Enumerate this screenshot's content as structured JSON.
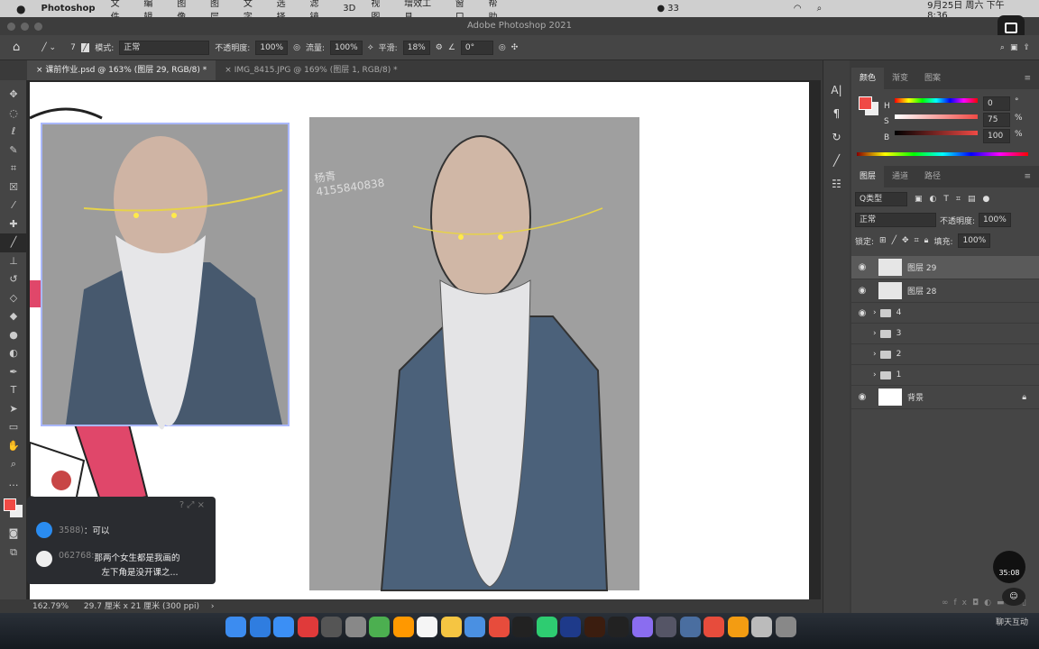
{
  "menubar": {
    "apple": "",
    "app": "Photoshop",
    "items": [
      "文件",
      "编辑",
      "图像",
      "图层",
      "文字",
      "选择",
      "滤镜",
      "3D",
      "视图",
      "增效工具",
      "窗口",
      "帮助"
    ],
    "battery_count": "33",
    "clock": "9月25日 周六 下午8:36"
  },
  "window": {
    "title": "Adobe Photoshop 2021"
  },
  "options": {
    "brush_size": "7",
    "mode_label": "模式:",
    "mode": "正常",
    "opacity_label": "不透明度:",
    "opacity": "100%",
    "flow_label": "流量:",
    "flow": "100%",
    "smooth_label": "平滑:",
    "smooth": "18%",
    "angle": "0°"
  },
  "tabs": [
    {
      "label": "课前作业.psd @ 163% (图层 29, RGB/8) *",
      "active": true
    },
    {
      "label": "IMG_8415.JPG @ 169% (图层 1, RGB/8) *",
      "active": false
    }
  ],
  "status": {
    "zoom": "162.79%",
    "size": "29.7 厘米 x 21 厘米 (300 ppi)",
    "arrow": "›"
  },
  "color_panel": {
    "tabs": [
      "颜色",
      "渐变",
      "图案"
    ],
    "h_label": "H",
    "s_label": "S",
    "b_label": "B",
    "h": "0",
    "s": "75",
    "b": "100",
    "deg": "°",
    "pct": "%",
    "foreground": "#f04a45"
  },
  "layers_panel": {
    "tabs": [
      "图层",
      "通道",
      "路径"
    ],
    "filter": "Q类型",
    "blend": "正常",
    "opacity_label": "不透明度:",
    "opacity": "100%",
    "lock_label": "锁定:",
    "fill_label": "填充:",
    "fill": "100%",
    "layers": [
      {
        "name": "图层 29",
        "visible": true,
        "type": "layer",
        "selected": true
      },
      {
        "name": "图层 28",
        "visible": true,
        "type": "layer"
      },
      {
        "name": "4",
        "visible": true,
        "type": "group"
      },
      {
        "name": "3",
        "visible": false,
        "type": "group"
      },
      {
        "name": "2",
        "visible": false,
        "type": "group"
      },
      {
        "name": "1",
        "visible": false,
        "type": "group"
      },
      {
        "name": "背景",
        "visible": true,
        "type": "background",
        "locked": true
      }
    ]
  },
  "chat": {
    "messages": [
      {
        "user": "3588)",
        "text": "：可以"
      },
      {
        "user": "062768:",
        "text": "那两个女生都是我画的",
        "text2": "左下角是没开课之..."
      }
    ]
  },
  "artwork": {
    "signature": "杨青 4155840838"
  },
  "timer": "35:08",
  "watermark": "聊天互动"
}
